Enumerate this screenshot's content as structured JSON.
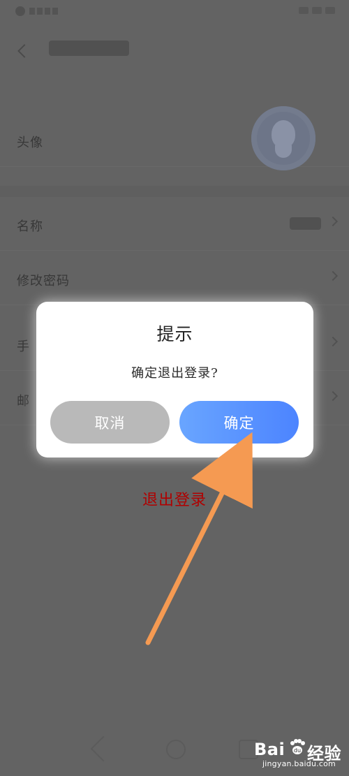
{
  "list": {
    "avatar_label": "头像",
    "name_label": "名称",
    "password_label": "修改密码",
    "phone_label": "手",
    "email_label": "邮"
  },
  "dialog": {
    "title": "提示",
    "message": "确定退出登录?",
    "cancel_label": "取消",
    "confirm_label": "确定"
  },
  "annotation": {
    "text": "退出登录"
  },
  "watermark": {
    "brand_left": "Bai",
    "brand_right": "经验",
    "site": "jingyan.baidu.com"
  },
  "colors": {
    "confirm_start": "#69a5ff",
    "confirm_end": "#4c84ff",
    "cancel": "#b9b9b9",
    "annotation": "#b00000",
    "arrow": "#f59a52"
  },
  "icons": {
    "back": "chevron-left-icon",
    "avatar": "user-icon",
    "arrow": "annotation-arrow-icon",
    "paw": "baidu-paw-icon"
  }
}
